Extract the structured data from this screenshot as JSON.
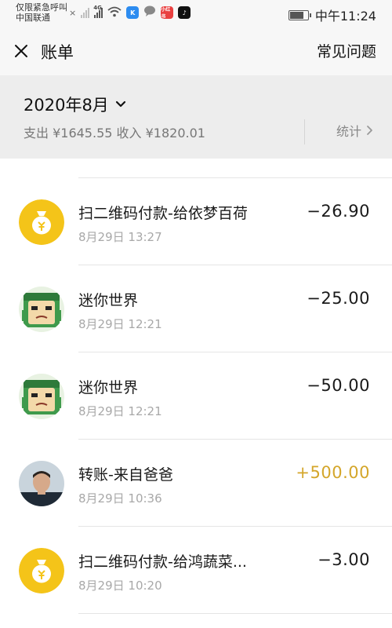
{
  "status_bar": {
    "carrier_line1": "仅限紧急呼叫",
    "carrier_line2": "中国联通",
    "x_mark": "×",
    "network": "4G",
    "time": "中午11:24",
    "battery_level": 0.8,
    "app_icons": [
      {
        "icon": "k-app-icon",
        "color": "#2d8cf0",
        "label": "K"
      },
      {
        "icon": "chat-bubble-icon",
        "color": "#888888",
        "label": ""
      },
      {
        "icon": "news-app-icon",
        "color": "#e94040",
        "label": "小红书"
      },
      {
        "icon": "tiktok-icon",
        "color": "#111111",
        "label": "♪"
      }
    ]
  },
  "nav": {
    "title": "账单",
    "faq": "常见问题"
  },
  "summary": {
    "month": "2020年8月",
    "totals": "支出 ¥1645.55 收入 ¥1820.01",
    "stats": "统计"
  },
  "transactions": [
    {
      "title": "扫二维码付款-给依梦百荷",
      "time": "8月29日 13:27",
      "amount": "−26.90",
      "type": "expense",
      "avatar": "moneybag-icon"
    },
    {
      "title": "迷你世界",
      "time": "8月29日 12:21",
      "amount": "−25.00",
      "type": "expense",
      "avatar": "mini-world-avatar"
    },
    {
      "title": "迷你世界",
      "time": "8月29日 12:21",
      "amount": "−50.00",
      "type": "expense",
      "avatar": "mini-world-avatar"
    },
    {
      "title": "转账-来自爸爸",
      "time": "8月29日 10:36",
      "amount": "+500.00",
      "type": "income",
      "avatar": "person-avatar"
    },
    {
      "title": "扫二维码付款-给鸿蔬菜...",
      "time": "8月29日 10:20",
      "amount": "−3.00",
      "type": "expense",
      "avatar": "moneybag-icon"
    }
  ],
  "colors": {
    "income": "#d4a62a",
    "moneybag": "#f4c419",
    "header_bg": "#ededed"
  }
}
